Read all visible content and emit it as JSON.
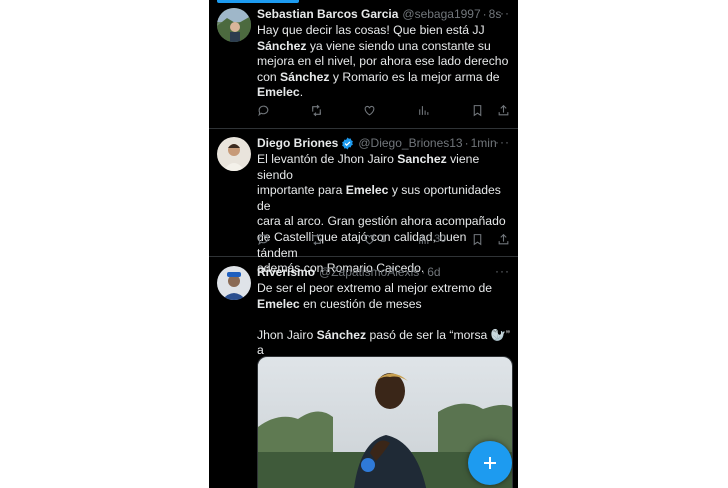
{
  "tweets": [
    {
      "name": "Sebastian Barcos Garcia",
      "handle": "@sebaga1997",
      "time": "8s",
      "verified": false,
      "segments": [
        {
          "t": "Hay que decir las cosas!  Que bien está JJ\n"
        },
        {
          "t": "Sánchez",
          "b": true
        },
        {
          "t": " ya viene siendo una constante su\nmejora en el nivel, por ahora ese lado derecho\ncon "
        },
        {
          "t": "Sánchez",
          "b": true
        },
        {
          "t": " y Romario es la mejor arma de\n"
        },
        {
          "t": "Emelec",
          "b": true
        },
        {
          "t": "."
        }
      ],
      "likes": "",
      "views": ""
    },
    {
      "name": "Diego Briones",
      "handle": "@Diego_Briones13",
      "time": "1min",
      "verified": true,
      "segments": [
        {
          "t": "El levantón de Jhon Jairo "
        },
        {
          "t": "Sanchez",
          "b": true
        },
        {
          "t": " viene siendo\nimportante para "
        },
        {
          "t": "Emelec",
          "b": true
        },
        {
          "t": " y sus oportunidades de\ncara al arco. Gran gestión ahora acompañado\nde Castelli que atajó con calidad, buen tándem\nademás con Romario Caicedo."
        }
      ],
      "likes": "1",
      "views": "30"
    },
    {
      "name": "Riverismo",
      "handle": "@ZapatismoAlexis",
      "time": "6d",
      "verified": false,
      "segments": [
        {
          "t": "De ser el peor extremo al mejor extremo de\n"
        },
        {
          "t": "Emelec",
          "b": true
        },
        {
          "t": " en cuestión de meses\n\nJhon Jairo "
        },
        {
          "t": "Sánchez",
          "b": true
        },
        {
          "t": " pasó de ser la “morsa 🦭” a\nser la “cabra 🐐”"
        }
      ],
      "likes": "",
      "views": ""
    }
  ],
  "icons": {
    "reply": "reply-icon",
    "retweet": "retweet-icon",
    "like": "heart-icon",
    "views": "views-icon",
    "bookmark": "bookmark-icon",
    "share": "share-icon",
    "more": "more-icon",
    "compose": "plus-icon"
  },
  "colors": {
    "background": "#000000",
    "text": "#e7e9ea",
    "muted": "#71767b",
    "accent": "#1d9bf0",
    "divider": "#2f3336"
  }
}
